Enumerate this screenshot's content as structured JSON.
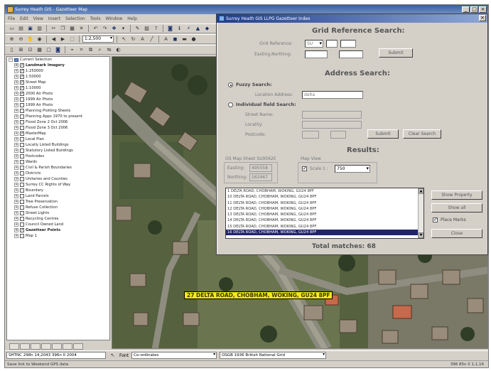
{
  "app": {
    "title": "Surrey Heath GIS - Gazetteer Map",
    "menu": [
      "File",
      "Edit",
      "View",
      "Insert",
      "Selection",
      "Tools",
      "Window",
      "Help"
    ],
    "scale": "1:2,500"
  },
  "toc": {
    "root": "Current Selection",
    "items": [
      {
        "label": "Landmark Imagery",
        "bold": true,
        "checked": true
      },
      {
        "label": "1:250000",
        "checked": true
      },
      {
        "label": "1:50000",
        "checked": true
      },
      {
        "label": "Street Map",
        "checked": true
      },
      {
        "label": "1:10000",
        "checked": true
      },
      {
        "label": "2000 Air Photo",
        "checked": true
      },
      {
        "label": "1999 Air Photo",
        "checked": false
      },
      {
        "label": "1999 Air Photo",
        "checked": false
      },
      {
        "label": "Planning Plotting Sheets",
        "checked": false
      },
      {
        "label": "Planning Apps 1970 to present",
        "checked": false
      },
      {
        "label": "Flood Zone 2 Oct 2006",
        "checked": false
      },
      {
        "label": "Flood Zone 3 Oct 2006",
        "checked": false
      },
      {
        "label": "MasterMap",
        "checked": true
      },
      {
        "label": "Local Plan",
        "checked": false
      },
      {
        "label": "Locally Listed Buildings",
        "checked": false
      },
      {
        "label": "Statutory Listed Buildings",
        "checked": false
      },
      {
        "label": "Postcodes",
        "checked": false
      },
      {
        "label": "Wards",
        "checked": false
      },
      {
        "label": "Civil & Parish Boundaries",
        "checked": false
      },
      {
        "label": "Districts",
        "checked": false
      },
      {
        "label": "Unitaries and Counties",
        "checked": false
      },
      {
        "label": "Surrey CC Rights of Way",
        "checked": false
      },
      {
        "label": "Boundary",
        "checked": false
      },
      {
        "label": "Land Parcels",
        "checked": false
      },
      {
        "label": "Tree Preservation",
        "checked": false
      },
      {
        "label": "Refuse Collection",
        "checked": false
      },
      {
        "label": "Street Lights",
        "checked": false
      },
      {
        "label": "Recycling Centres",
        "checked": false
      },
      {
        "label": "Council Owned Land",
        "checked": false
      },
      {
        "label": "Gazetteer Points",
        "bold": true,
        "checked": true
      },
      {
        "label": "Map 1",
        "checked": false
      }
    ]
  },
  "map": {
    "label": "27 DELTA ROAD, CHOBHAM, WOKING, GU24 8PF"
  },
  "bottombar": {
    "coords": "SHTNC 298n 14,2043 396n 0 2004",
    "font_label": "Font",
    "font_value": "Co-ordinates",
    "style_value": "OSGB 1936 British National Grid"
  },
  "status": {
    "left": "Save link to Weekend GPS data",
    "right": "396 85n   0 1,1,16"
  },
  "dialog": {
    "title": "Surrey Heath GIS LLPG Gazetteer Index",
    "grid": {
      "heading": "Grid Reference Search:",
      "grid_ref_label": "Grid Reference:",
      "grid_ref_value": "SU",
      "easting_label": "Easting,Northing:",
      "submit": "Submit"
    },
    "address": {
      "heading": "Address Search:",
      "fuzzy_label": "Fuzzy Search:",
      "location_label": "Location Address:",
      "location_value": "delta",
      "individual_label": "Individual field Search:",
      "street_label": "Street Name:",
      "locality_label": "Locality:",
      "postcode_label": "Postcode:",
      "submit": "Submit",
      "clear": "Clear Search"
    },
    "results": {
      "heading": "Results:",
      "osmap_label": "OS Map Sheet SU9562E",
      "easting_label": "Easting:",
      "easting_value": "495558",
      "northing_label": "Northing:",
      "northing_value": "162467",
      "mapview_label": "Map View",
      "scale_label": "Scale 1 :",
      "scale_value": "750",
      "items": [
        "1 DELTA ROAD, CHOBHAM, WOKING, GU24 8PF",
        "10 DELTA ROAD, CHOBHAM, WOKING, GU24 8PF",
        "11 DELTA ROAD, CHOBHAM, WOKING, GU24 8PF",
        "12 DELTA ROAD, CHOBHAM, WOKING, GU24 8PF",
        "13 DELTA ROAD, CHOBHAM, WOKING, GU24 8PF",
        "14 DELTA ROAD, CHOBHAM, WOKING, GU24 8PF",
        "15 DELTA ROAD, CHOBHAM, WOKING, GU24 8PF",
        "16 DELTA ROAD, CHOBHAM, WOKING, GU24 8PF"
      ],
      "selected_index": 7,
      "show_property": "Show Property",
      "show_all": "Show all",
      "place_marks": "Place Marks",
      "close": "Close",
      "total": "Total matches: 68"
    }
  }
}
